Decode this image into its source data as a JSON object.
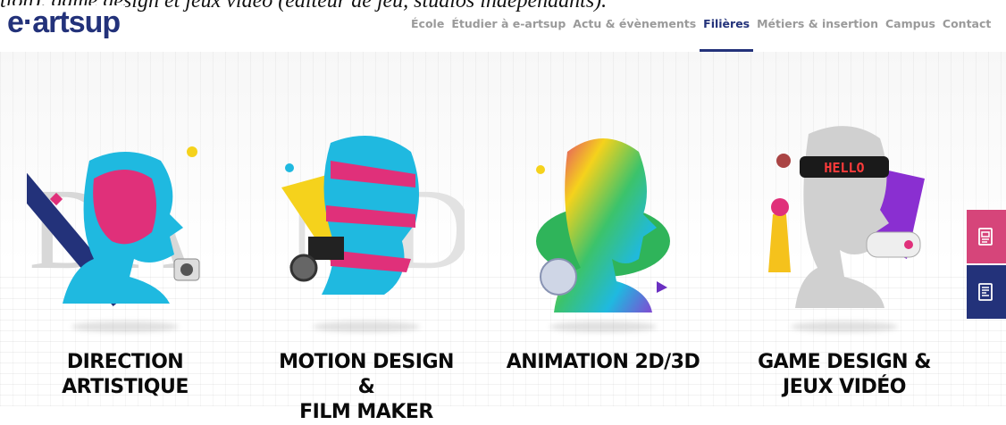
{
  "caption": "tion), game design et jeux vidéo (éditeur de jeu, studios indépendants).",
  "logo": "e·artsup",
  "nav": [
    {
      "label": "École"
    },
    {
      "label": "Étudier à e-artsup"
    },
    {
      "label": "Actu & évènements"
    },
    {
      "label": "Filières",
      "active": true
    },
    {
      "label": "Métiers & insertion"
    },
    {
      "label": "Campus"
    },
    {
      "label": "Contact"
    }
  ],
  "cards": [
    {
      "title_line1": "DIRECTION",
      "title_line2": "ARTISTIQUE",
      "letters": "DA",
      "icon": "bust-da-icon"
    },
    {
      "title_line1": "MOTION DESIGN &",
      "title_line2": "FILM MAKER",
      "letters": "MD",
      "icon": "bust-motion-icon"
    },
    {
      "title_line1": "ANIMATION 2D/3D",
      "title_line2": "",
      "letters": "",
      "icon": "bust-animation-icon"
    },
    {
      "title_line1": "GAME DESIGN &",
      "title_line2": "JEUX VIDÉO",
      "letters": "",
      "icon": "bust-game-icon",
      "badge": "HELLO"
    }
  ],
  "side_buttons": [
    {
      "icon": "brochure-icon",
      "color": "#d6457a"
    },
    {
      "icon": "application-form-icon",
      "color": "#23327a"
    }
  ],
  "colors": {
    "brand": "#23327a",
    "pink": "#e0307a",
    "cyan": "#1fb9e0",
    "yellow": "#f5d21c"
  }
}
